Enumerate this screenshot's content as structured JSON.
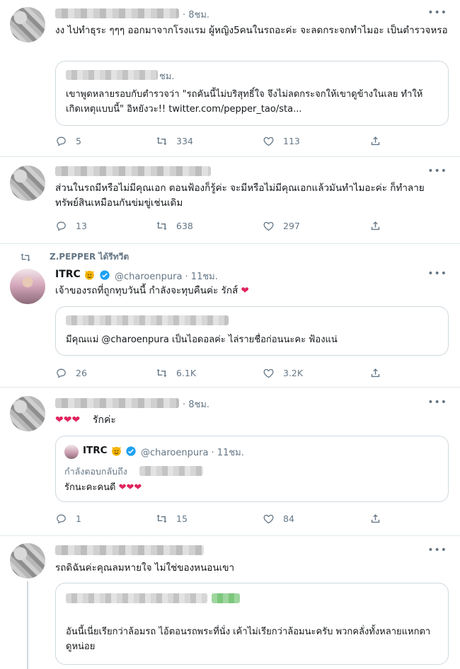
{
  "tweets": [
    {
      "time": "· 8ชม.",
      "text": "งง ไปทำธุระ ๆๆๆ ออกมาจากโรงแรม ผู้หญิง5คนในรถอะค่ะ  จะลดกระจกทำไมอะ เป็นตำรวจหรอ",
      "quote": {
        "time": "ชม.",
        "text": "เขาพูดหลายรอบกับตำรวจว่า \"รถคันนี้ไม่บริสุทธิ์ใจ จึงไม่ลดกระจกให้เขาดูข้างในเลย ทำให้เกิดเหตุแบบนี้\" อิหยังวะ!! twitter.com/pepper_tao/sta..."
      },
      "replies": "5",
      "retweets": "334",
      "likes": "113"
    },
    {
      "text": "ส่วนในรถมีหรือไม่มีคุณเอก ตอนฟ้องก็รู้ค่ะ  จะมีหรือไม่มีคุณเอกแล้วมันทำไมอะค่ะ ก็ทำลายทรัพย์สินเหมือนกันข่มขู่เช่นเดิม",
      "replies": "13",
      "retweets": "638",
      "likes": "297"
    },
    {
      "retweeted_by": "Z.PEPPER ได้รีทวีต",
      "name": "ITRC",
      "handle": "@charoenpura · 11ชม.",
      "text": "เจ้าของรถที่ถูกทุบวันนี้ กำลังจะทุบคืนค่ะ รักส์",
      "quote": {
        "text": "มีคุณแม่ @charoenpura เป็นไอดอลค่ะ ไล่รายชื่อก่อนนะคะ ฟ้องแน่"
      },
      "replies": "26",
      "retweets": "6.1K",
      "likes": "3.2K"
    },
    {
      "time": "· 8ชม.",
      "text": "รักค่ะ",
      "quote": {
        "name": "ITRC",
        "handle": "@charoenpura · 11ชม.",
        "reply_to": "กำลังตอบกลับถึง",
        "text": "รักนะคะคนดี"
      },
      "replies": "1",
      "retweets": "15",
      "likes": "84"
    },
    {
      "text": "รถดิฉันค่ะคุณลมหายใจ ไม่ใช่ของหนอนเขา",
      "quote": {
        "text": "อันนี้เนี่ยเรียกว่าล้อมรถ ไอ้ตอนรถพระที่นั่ง เค้าไม่เรียกว่าล้อมนะครับ พวกคลั่งทั้งหลายแหกตาดูหน่อย"
      }
    }
  ],
  "more_label": "•••",
  "icons": {
    "reply": "reply-icon",
    "retweet": "retweet-icon",
    "like": "heart-icon",
    "share": "share-icon",
    "verified": "verified-badge-icon",
    "devil_emoji": "smiling-devil-emoji"
  },
  "colors": {
    "heart": "#e0245e",
    "verified": "#1da1f2",
    "muted": "#657786"
  }
}
